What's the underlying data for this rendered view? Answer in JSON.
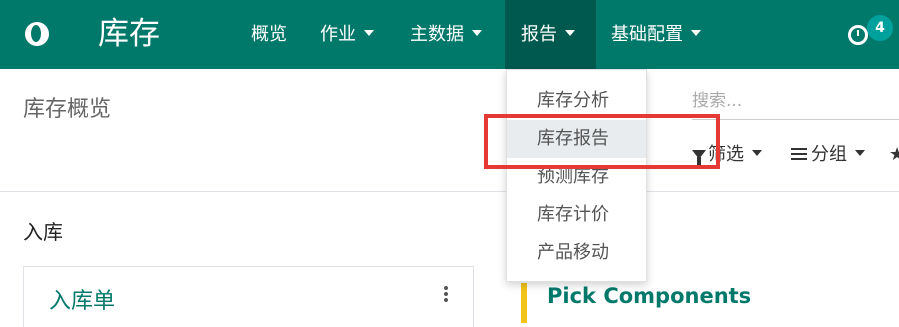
{
  "navbar": {
    "app_title": "库存",
    "menus": [
      {
        "label": "概览",
        "has_caret": false
      },
      {
        "label": "作业",
        "has_caret": true
      },
      {
        "label": "主数据",
        "has_caret": true
      },
      {
        "label": "报告",
        "has_caret": true,
        "active": true
      },
      {
        "label": "基础配置",
        "has_caret": true
      }
    ],
    "activity_badge": "4",
    "icons": {
      "logo": "odoo-logo-icon",
      "activity": "clock-icon"
    },
    "colors": {
      "brand": "#00796b",
      "active_menu": "#00594f",
      "badge": "#00a09d"
    }
  },
  "reports_dropdown": {
    "items": [
      {
        "label": "库存分析"
      },
      {
        "label": "库存报告",
        "highlighted": true
      },
      {
        "label": "预测库存"
      },
      {
        "label": "库存计价"
      },
      {
        "label": "产品移动"
      }
    ]
  },
  "control_panel": {
    "breadcrumb": "库存概览",
    "search_placeholder": "搜索...",
    "filter_label": "筛选",
    "group_label": "分组",
    "icons": {
      "filter": "funnel-icon",
      "group": "bars-icon",
      "favorites": "star-icon"
    }
  },
  "content": {
    "section_title": "入库",
    "card1_title": "入库单",
    "card2_title": "Pick Components",
    "colors": {
      "card2_accent": "#f0c419",
      "highlight": "#e53935"
    }
  }
}
